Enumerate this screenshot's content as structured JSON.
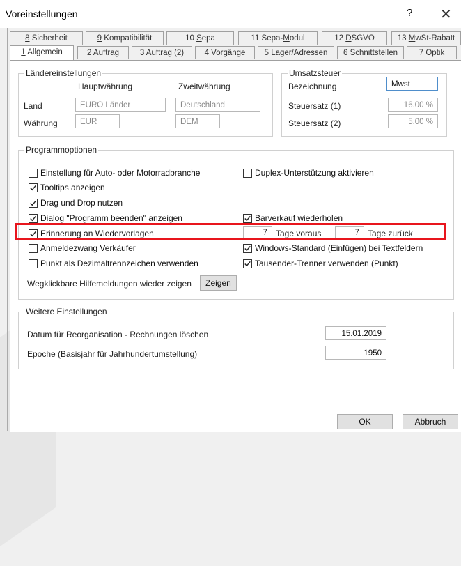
{
  "window": {
    "title": "Voreinstellungen",
    "help": "?",
    "close": "✕"
  },
  "tabs_row1": [
    {
      "u": "8",
      "rest": " Sicherheit"
    },
    {
      "u": "9",
      "rest": " Kompatibilität"
    },
    {
      "pre": "10 ",
      "u": "S",
      "rest": "epa"
    },
    {
      "pre": "11 Sepa-",
      "u": "M",
      "rest": "odul"
    },
    {
      "pre": "12 ",
      "u": "D",
      "rest": "SGVO"
    },
    {
      "pre": "13 ",
      "u": "M",
      "rest": "wSt-Rabatt"
    }
  ],
  "tabs_row2": [
    {
      "u": "1",
      "rest": " Allgemein"
    },
    {
      "u": "2",
      "rest": " Auftrag"
    },
    {
      "u": "3",
      "rest": " Auftrag (2)"
    },
    {
      "u": "4",
      "rest": " Vorgänge"
    },
    {
      "u": "5",
      "rest": " Lager/Adressen"
    },
    {
      "u": "6",
      "rest": " Schnittstellen"
    },
    {
      "u": "7",
      "rest": " Optik"
    }
  ],
  "laender": {
    "legend": "Ländereinstellungen",
    "col_haupt": "Hauptwährung",
    "col_zweit": "Zweitwährung",
    "land_label": "Land",
    "land_haupt": "EURO Länder",
    "land_zweit": "Deutschland",
    "waehrung_label": "Währung",
    "waehrung_haupt": "EUR",
    "waehrung_zweit": "DEM"
  },
  "ust": {
    "legend": "Umsatzsteuer",
    "bez_label": "Bezeichnung",
    "bez_value": "Mwst",
    "satz1_label": "Steuersatz (1)",
    "satz1_value": "16.00 %",
    "satz2_label": "Steuersatz (2)",
    "satz2_value": "5.00 %"
  },
  "prog": {
    "legend": "Programmoptionen",
    "opt1": {
      "label": "Einstellung für Auto- oder Motorradbranche",
      "checked": false
    },
    "opt2": {
      "label": "Tooltips anzeigen",
      "checked": true
    },
    "opt3": {
      "label": "Drag und Drop nutzen",
      "checked": true
    },
    "opt4": {
      "label": "Dialog \"Programm beenden\" anzeigen",
      "checked": true
    },
    "opt5": {
      "label": "Erinnerung an Wiedervorlagen",
      "checked": true
    },
    "opt6": {
      "label": "Anmeldezwang Verkäufer",
      "checked": false
    },
    "opt7": {
      "label": "Punkt als Dezimaltrennzeichen verwenden",
      "checked": false
    },
    "opt8": {
      "label": "Duplex-Unterstützung aktivieren",
      "checked": false
    },
    "opt9": {
      "label": "Barverkauf wiederholen",
      "checked": true
    },
    "opt10": {
      "label": "Windows-Standard (Einfügen) bei Textfeldern",
      "checked": true
    },
    "opt11": {
      "label": "Tausender-Trenner verwenden (Punkt)",
      "checked": true
    },
    "tage_voraus_value": "7",
    "tage_voraus_label": "Tage voraus",
    "tage_zurueck_value": "7",
    "tage_zurueck_label": "Tage zurück",
    "hilfe_label": "Wegklickbare Hilfemeldungen wieder zeigen",
    "zeigen_button": "Zeigen"
  },
  "weitere": {
    "legend": "Weitere Einstellungen",
    "reorg_label": "Datum für Reorganisation - Rechnungen löschen",
    "reorg_value": "15.01.2019",
    "epoche_label": "Epoche (Basisjahr für Jahrhundertumstellung)",
    "epoche_value": "1950"
  },
  "buttons": {
    "ok": "OK",
    "abbruch": "Abbruch"
  }
}
